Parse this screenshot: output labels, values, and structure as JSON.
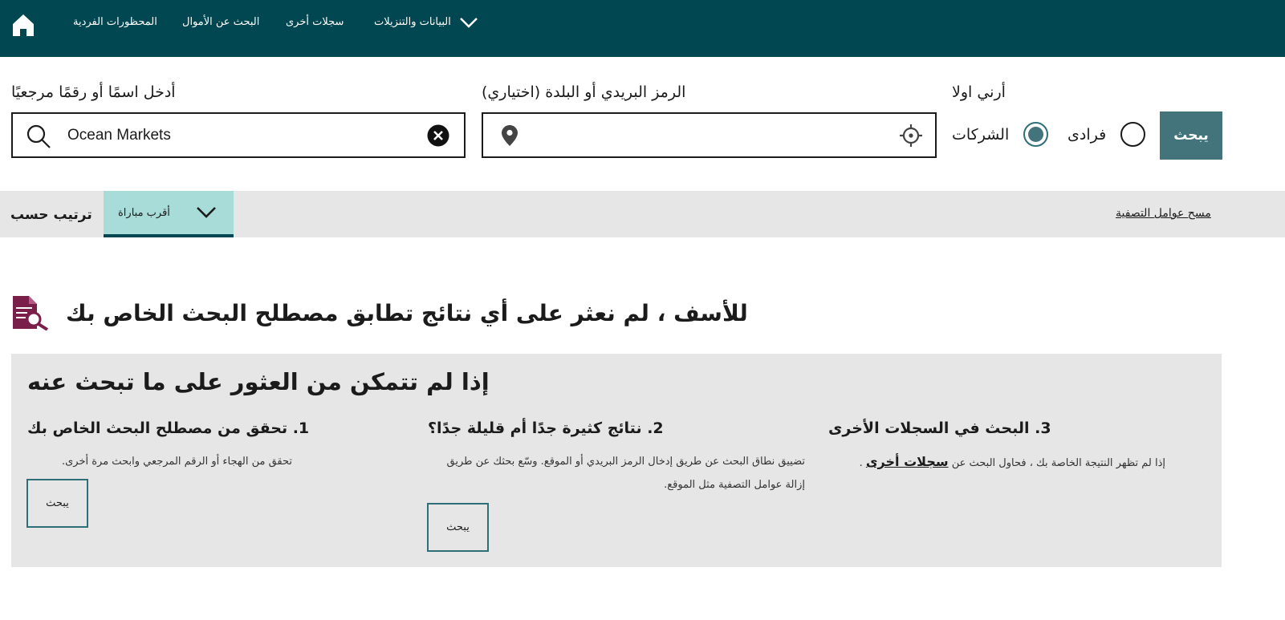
{
  "nav": {
    "items": [
      "المحظورات الفردية",
      "البحث عن الأموال",
      "سجلات أخرى",
      "البيانات والتنزيلات"
    ]
  },
  "search": {
    "name_label": "أدخل اسمًا أو رقمًا مرجعيًا",
    "name_value": "Ocean Markets",
    "postcode_label": "الرمز البريدي أو البلدة (اختياري)",
    "postcode_value": "",
    "show_label": "أرني اولا",
    "options": [
      "الشركات",
      "فرادى"
    ],
    "selected_option": "الشركات",
    "submit_label": "يبحث"
  },
  "sort": {
    "label": "ترتيب حسب",
    "selected": "أقرب مباراة",
    "clear_filters": "مسح عوامل التصفية"
  },
  "no_results": {
    "title": "للأسف ، لم نعثر على أي نتائج تطابق مصطلح البحث الخاص بك"
  },
  "help": {
    "title": "إذا لم تتمكن من العثور على ما تبحث عنه",
    "columns": [
      {
        "heading": "1. تحقق من مصطلح البحث الخاص بك",
        "text": "تحقق من الهجاء أو الرقم المرجعي وابحث مرة أخرى.",
        "button": "يبحث"
      },
      {
        "heading": "2. نتائج كثيرة جدًا أم قليلة جدًا؟",
        "text": "تضييق نطاق البحث عن طريق إدخال الرمز البريدي أو الموقع. وسّع بحثك عن طريق إزالة عوامل التصفية مثل الموقع.",
        "button": "يبحث"
      },
      {
        "heading": "3. البحث في السجلات الأخرى",
        "text_before": "إذا لم تظهر النتيجة الخاصة بك ، فحاول البحث عن",
        "link": "سجلات أخرى",
        "text_after": "."
      }
    ]
  },
  "colors": {
    "header": "#004752",
    "accent": "#43747c",
    "sort_selected": "#a8dcd9",
    "panel": "#e6e6e6",
    "icon": "#7a1e4a"
  }
}
